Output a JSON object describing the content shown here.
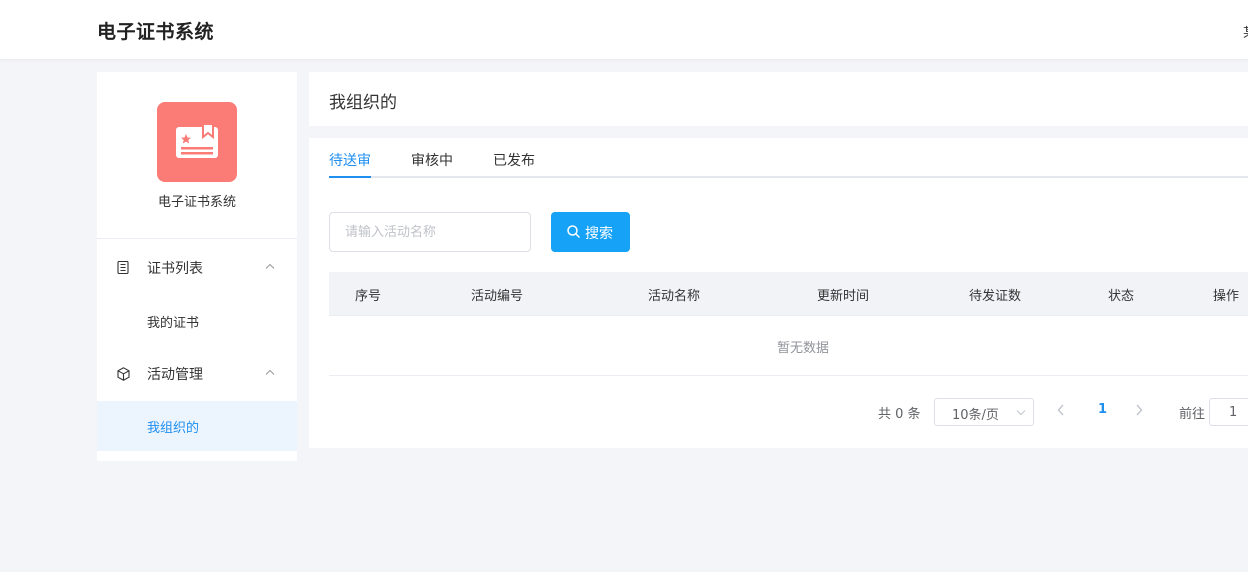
{
  "header": {
    "brand": "电子证书系统",
    "edge_text": "某"
  },
  "sidebar": {
    "logo_icon": "certificate-icon",
    "title": "电子证书系统",
    "groups": [
      {
        "label": "证书列表",
        "icon": "document-icon",
        "items": [
          {
            "label": "我的证书"
          }
        ]
      },
      {
        "label": "活动管理",
        "icon": "cube-icon",
        "items": [
          {
            "label": "我组织的",
            "active": true
          }
        ]
      }
    ]
  },
  "page": {
    "title": "我组织的"
  },
  "tabs": [
    {
      "label": "待送审",
      "active": true
    },
    {
      "label": "审核中"
    },
    {
      "label": "已发布"
    }
  ],
  "search": {
    "placeholder": "请输入活动名称",
    "button_label": "搜索"
  },
  "table": {
    "columns": [
      "序号",
      "活动编号",
      "活动名称",
      "更新时间",
      "待发证数",
      "状态",
      "操作"
    ],
    "empty_text": "暂无数据"
  },
  "pagination": {
    "total_text": "共 0 条",
    "page_size": "10条/页",
    "current_page": "1",
    "goto_label": "前往",
    "goto_value": "1"
  },
  "colors": {
    "accent": "#1f8ff0",
    "button": "#16a2f6",
    "logo_bg": "#fb7b76"
  }
}
